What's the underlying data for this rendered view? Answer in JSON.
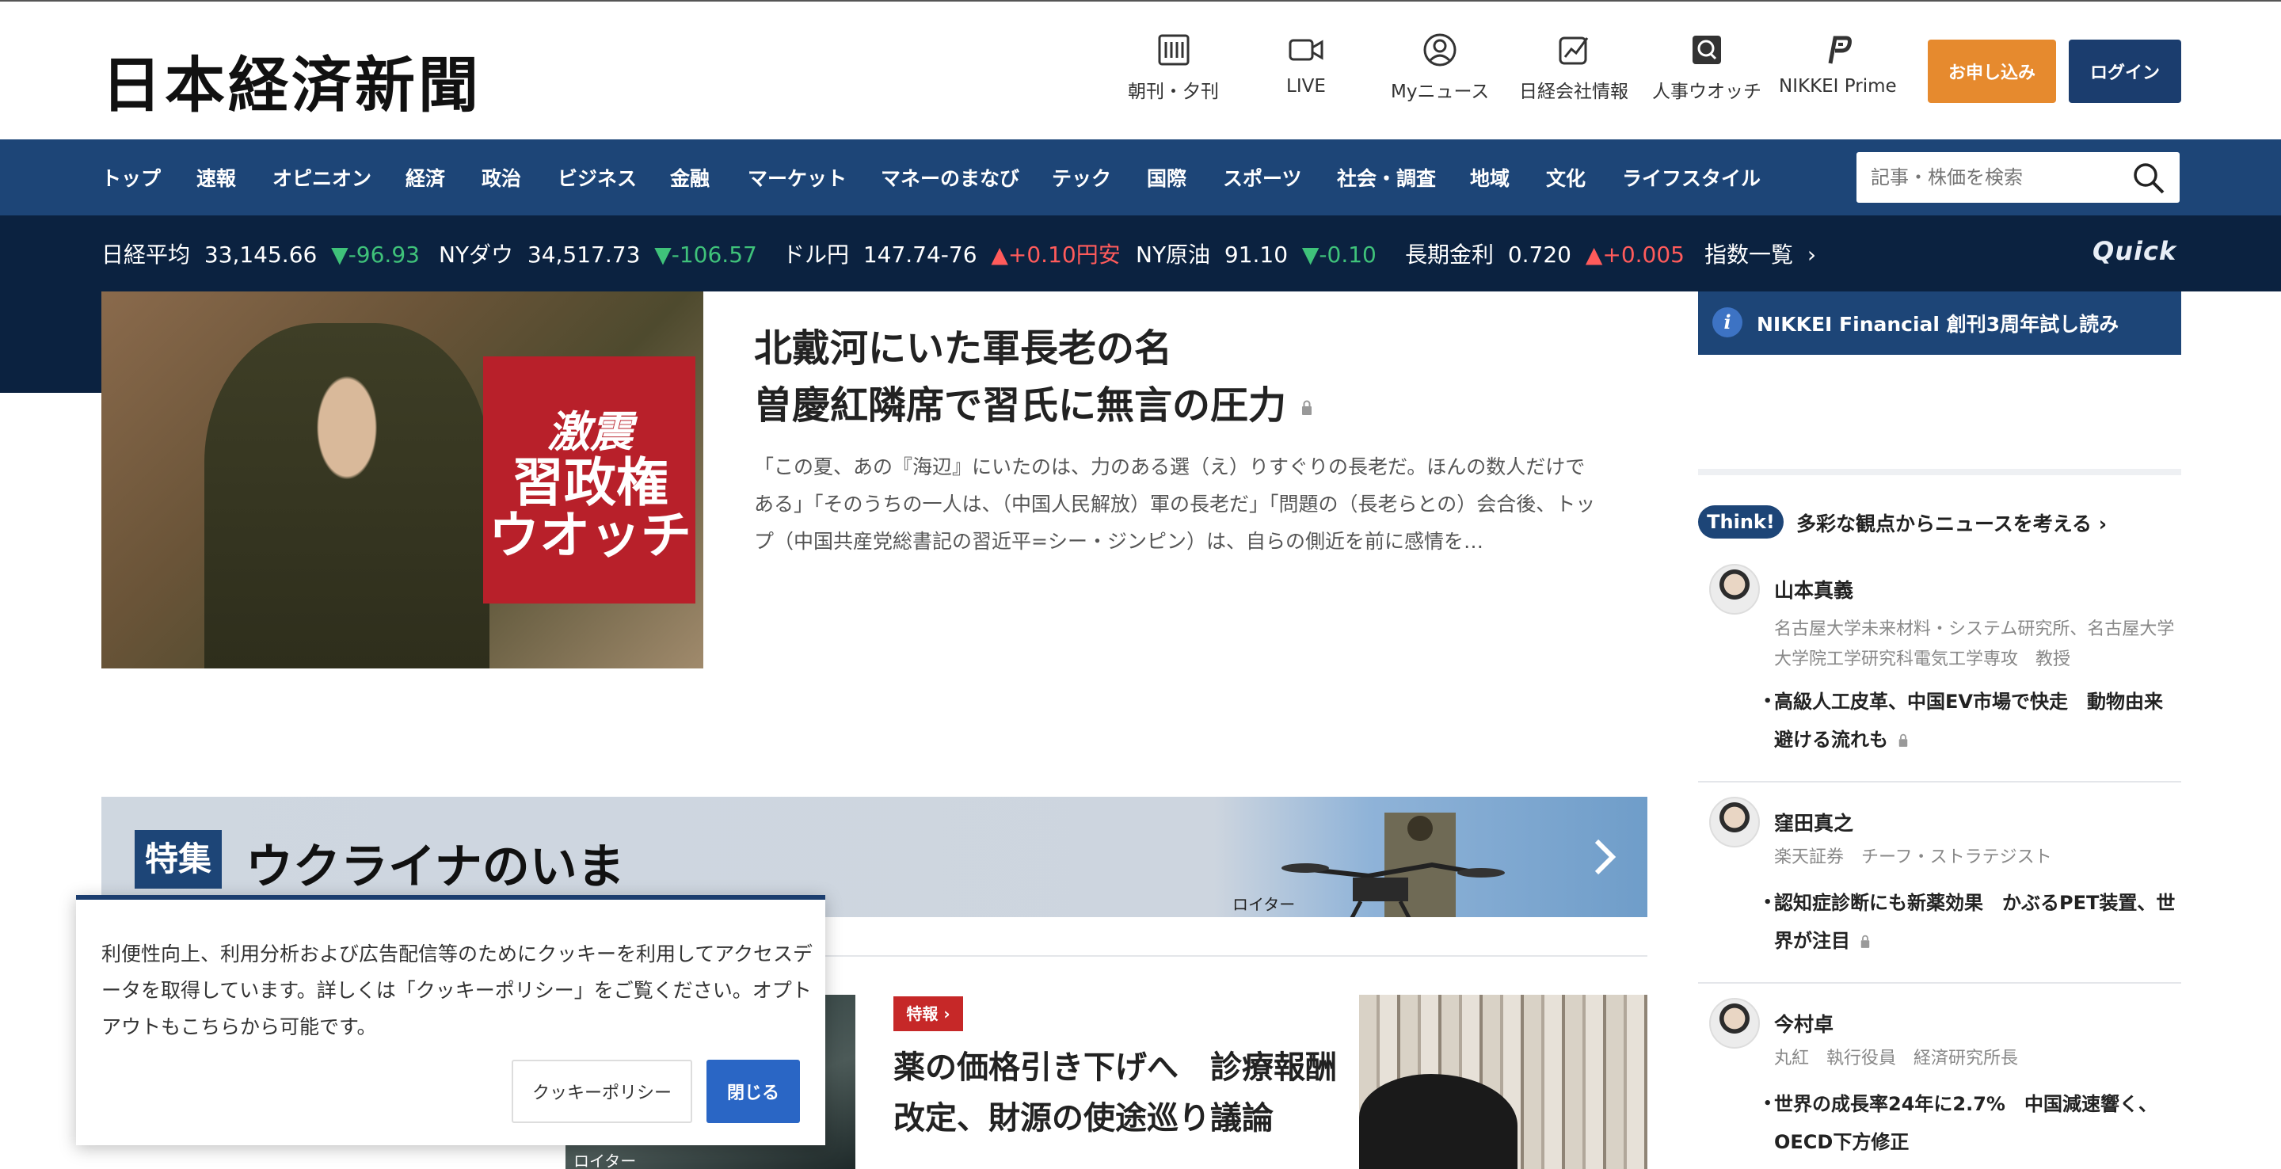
{
  "header": {
    "logo": "日本経済新聞",
    "utilities": [
      {
        "label": "朝刊・夕刊",
        "icon": "newspaper-icon"
      },
      {
        "label": "LIVE",
        "icon": "video-camera-icon"
      },
      {
        "label": "Myニュース",
        "icon": "user-circle-icon"
      },
      {
        "label": "日経会社情報",
        "icon": "chart-icon"
      },
      {
        "label": "人事ウオッチ",
        "icon": "search-person-icon"
      },
      {
        "label": "NIKKEI Prime",
        "icon": "prime-icon"
      }
    ],
    "apply_label": "お申し込み",
    "login_label": "ログイン"
  },
  "nav": {
    "items": [
      "トップ",
      "速報",
      "オピニオン",
      "経済",
      "政治",
      "ビジネス",
      "金融",
      "マーケット",
      "マネーのまなび",
      "テック",
      "国際",
      "スポーツ",
      "社会・調査",
      "地域",
      "文化",
      "ライフスタイル"
    ],
    "search_placeholder": "記事・株価を検索"
  },
  "ticker": {
    "items": [
      {
        "name": "日経平均",
        "value": "33,145.66",
        "change": "-96.93",
        "direction": "down"
      },
      {
        "name": "NYダウ",
        "value": "34,517.73",
        "change": "-106.57",
        "direction": "down"
      },
      {
        "name": "ドル円",
        "value": "147.74-76",
        "change": "+0.10円安",
        "direction": "up"
      },
      {
        "name": "NY原油",
        "value": "91.10",
        "change": "-0.10",
        "direction": "down"
      },
      {
        "name": "長期金利",
        "value": "0.720",
        "change": "+0.005",
        "direction": "up"
      }
    ],
    "index_list_label": "指数一覧",
    "quick_logo": "Quick"
  },
  "hero": {
    "image_overlay": {
      "line1": "激震",
      "line2": "習政権",
      "line3": "ウオッチ"
    },
    "title_line1": "北戴河にいた軍長老の名",
    "title_line2": "曽慶紅隣席で習氏に無言の圧力",
    "lead": "「この夏、あの『海辺』にいたのは、力のある選（え）りすぐりの長老だ。ほんの数人だけである」「そのうちの一人は、（中国人民解放）軍の長老だ」「問題の（長老らとの）会合後、トップ（中国共産党総書記の習近平=シー・ジンピン）は、自らの側近を前に感情を…"
  },
  "sidebar": {
    "financial_banner": "NIKKEI Financial 創刊3周年試し読み",
    "think_badge": "Think!",
    "think_title": "多彩な観点からニュースを考える",
    "experts": [
      {
        "name": "山本真義",
        "role": "名古屋大学未来材料・システム研究所、名古屋大学大学院工学研究科電気工学専攻　教授",
        "topic": "高級人工皮革、中国EV市場で快走　動物由来避ける流れも"
      },
      {
        "name": "窪田真之",
        "role": "楽天証券　チーフ・ストラテジスト",
        "topic": "認知症診断にも新薬効果　かぶるPET装置、世界が注目"
      },
      {
        "name": "今村卓",
        "role": "丸紅　執行役員　経済研究所長",
        "topic": "世界の成長率24年に2.7%　中国減速響く、OECD下方修正"
      }
    ]
  },
  "special": {
    "badge": "特集",
    "title": "ウクライナのいま",
    "credit": "ロイター"
  },
  "cards": {
    "credit": "ロイター",
    "breaking_label": "特報",
    "title": "薬の価格引き下げへ　診療報酬改定、財源の使途巡り議論"
  },
  "cookie": {
    "text": "利便性向上、利用分析および広告配信等のためにクッキーを利用してアクセスデータを取得しています。詳しくは「クッキーポリシー」をご覧ください。オプトアウトもこちらから可能です。",
    "policy_label": "クッキーポリシー",
    "close_label": "閉じる"
  },
  "colors": {
    "nav_bg": "#1d4577",
    "ticker_bg": "#0b2240",
    "apply_button": "#e68a2e",
    "down": "#3fc27a",
    "up": "#ff5b5b"
  }
}
